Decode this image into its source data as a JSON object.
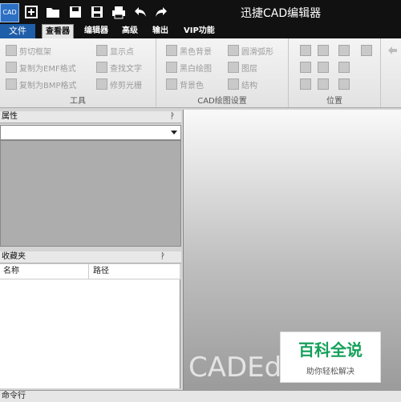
{
  "app": {
    "icon_text": "CAD",
    "title": "迅捷CAD编辑器"
  },
  "menu": {
    "file": "文件",
    "tabs": [
      "查看器",
      "编辑器",
      "高级",
      "输出",
      "VIP功能"
    ]
  },
  "ribbon": {
    "tools": {
      "label": "工具",
      "items": [
        "剪切框架",
        "复制为EMF格式",
        "复制为BMP格式",
        "显示点",
        "查找文字",
        "修剪光栅"
      ]
    },
    "cad_settings": {
      "label": "CAD绘图设置",
      "items": [
        "黑色背景",
        "黑白绘图",
        "背景色",
        "圆滑弧形",
        "图层",
        "结构"
      ]
    },
    "position": {
      "label": "位置"
    }
  },
  "panels": {
    "properties": {
      "title": "属性",
      "pin": "ᚹ"
    },
    "favorites": {
      "title": "收藏夹",
      "pin": "ᚹ",
      "columns": [
        "名称",
        "路径"
      ]
    }
  },
  "canvas": {
    "watermark": "CADEdit"
  },
  "badge": {
    "title": "百科全说",
    "subtitle": "助你轻松解决"
  },
  "statusbar": {
    "command_label": "命令行"
  },
  "colors": {
    "titlebar": "#111111",
    "accent": "#1f5ea8",
    "badge_green": "#15a05a"
  }
}
